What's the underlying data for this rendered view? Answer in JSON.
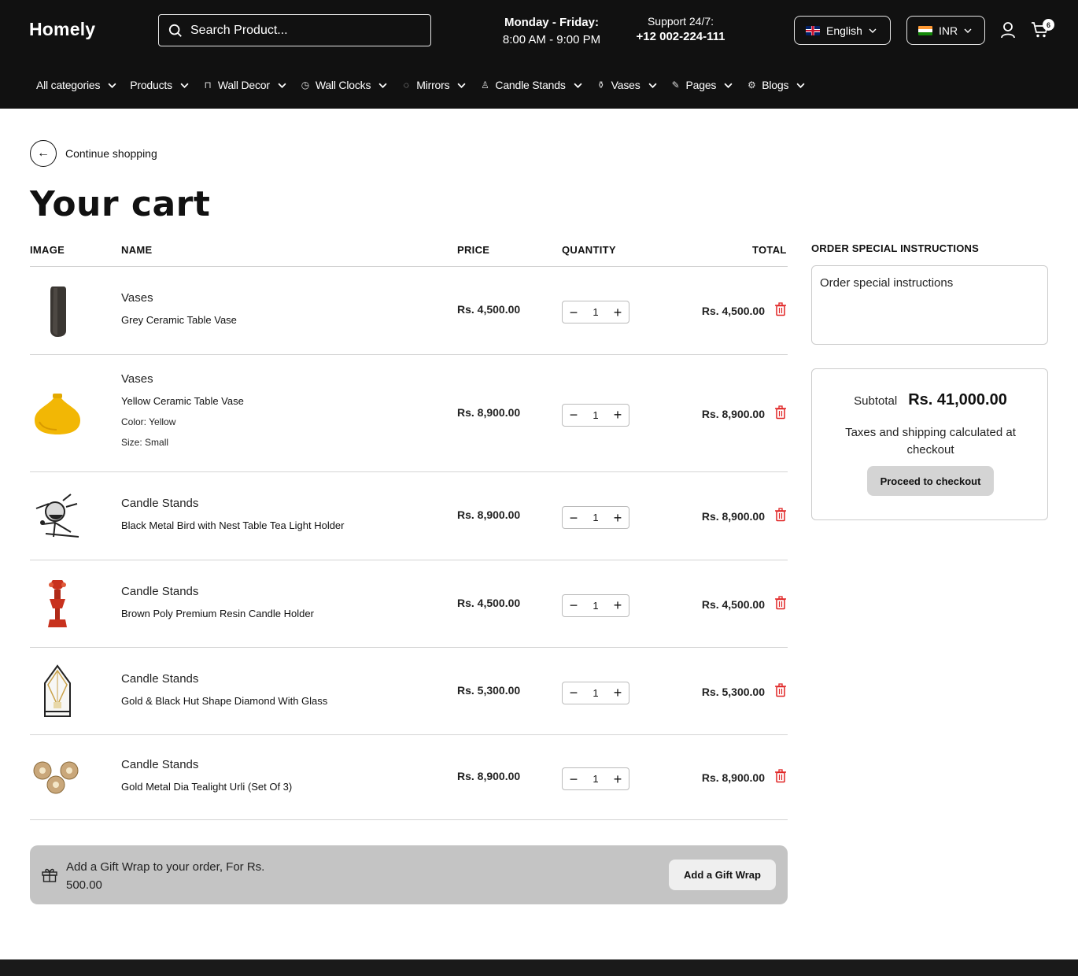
{
  "header": {
    "logo": "Homely",
    "search_placeholder": "Search Product...",
    "hours_days": "Monday - Friday:",
    "hours_time": "8:00 AM - 9:00 PM",
    "support_label": "Support 24/7:",
    "support_phone": "+12 002-224-111",
    "language": "English",
    "currency": "INR",
    "cart_count": "6"
  },
  "nav": [
    {
      "label": "All categories",
      "icon": ""
    },
    {
      "label": "Products",
      "icon": ""
    },
    {
      "label": "Wall Decor",
      "icon": "wall-decor-icon"
    },
    {
      "label": "Wall Clocks",
      "icon": "clock-icon"
    },
    {
      "label": "Mirrors",
      "icon": "mirror-icon"
    },
    {
      "label": "Candle Stands",
      "icon": "candle-icon"
    },
    {
      "label": "Vases",
      "icon": "vase-icon"
    },
    {
      "label": "Pages",
      "icon": "pencil-icon"
    },
    {
      "label": "Blogs",
      "icon": "gear-icon"
    }
  ],
  "main": {
    "back_label": "Continue shopping",
    "title": "Your cart",
    "columns": {
      "image": "IMAGE",
      "name": "NAME",
      "price": "PRICE",
      "quantity": "QUANTITY",
      "total": "TOTAL"
    },
    "items": [
      {
        "category": "Vases",
        "name": "Grey Ceramic Table Vase",
        "options": [],
        "price": "Rs. 4,500.00",
        "qty": "1",
        "total": "Rs. 4,500.00",
        "image": "grey-vase"
      },
      {
        "category": "Vases",
        "name": "Yellow Ceramic Table Vase",
        "options": [
          {
            "label": "Color:",
            "value": "Yellow"
          },
          {
            "label": "Size:",
            "value": "Small"
          }
        ],
        "price": "Rs. 8,900.00",
        "qty": "1",
        "total": "Rs. 8,900.00",
        "image": "yellow-vase"
      },
      {
        "category": "Candle Stands",
        "name": "Black Metal Bird with Nest Table Tea Light Holder",
        "options": [],
        "price": "Rs. 8,900.00",
        "qty": "1",
        "total": "Rs. 8,900.00",
        "image": "bird-holder"
      },
      {
        "category": "Candle Stands",
        "name": "Brown Poly Premium Resin Candle Holder",
        "options": [],
        "price": "Rs. 4,500.00",
        "qty": "1",
        "total": "Rs. 4,500.00",
        "image": "resin-holder"
      },
      {
        "category": "Candle Stands",
        "name": "Gold & Black Hut Shape Diamond With Glass",
        "options": [],
        "price": "Rs. 5,300.00",
        "qty": "1",
        "total": "Rs. 5,300.00",
        "image": "hut-lantern"
      },
      {
        "category": "Candle Stands",
        "name": "Gold Metal Dia Tealight Urli (Set Of 3)",
        "options": [],
        "price": "Rs. 8,900.00",
        "qty": "1",
        "total": "Rs. 8,900.00",
        "image": "urli-set"
      }
    ],
    "gift_text": "Add a Gift Wrap to your order, For Rs. 500.00",
    "gift_button": "Add a Gift Wrap"
  },
  "sidebar": {
    "instructions_label": "ORDER SPECIAL INSTRUCTIONS",
    "instructions_placeholder": "Order special instructions",
    "subtotal_label": "Subtotal",
    "subtotal_value": "Rs. 41,000.00",
    "tax_note": "Taxes and shipping calculated at checkout",
    "checkout_button": "Proceed to checkout"
  },
  "colors": {
    "header_bg": "#111111",
    "trash": "#e02424",
    "gift_bg": "#c4c4c4"
  }
}
